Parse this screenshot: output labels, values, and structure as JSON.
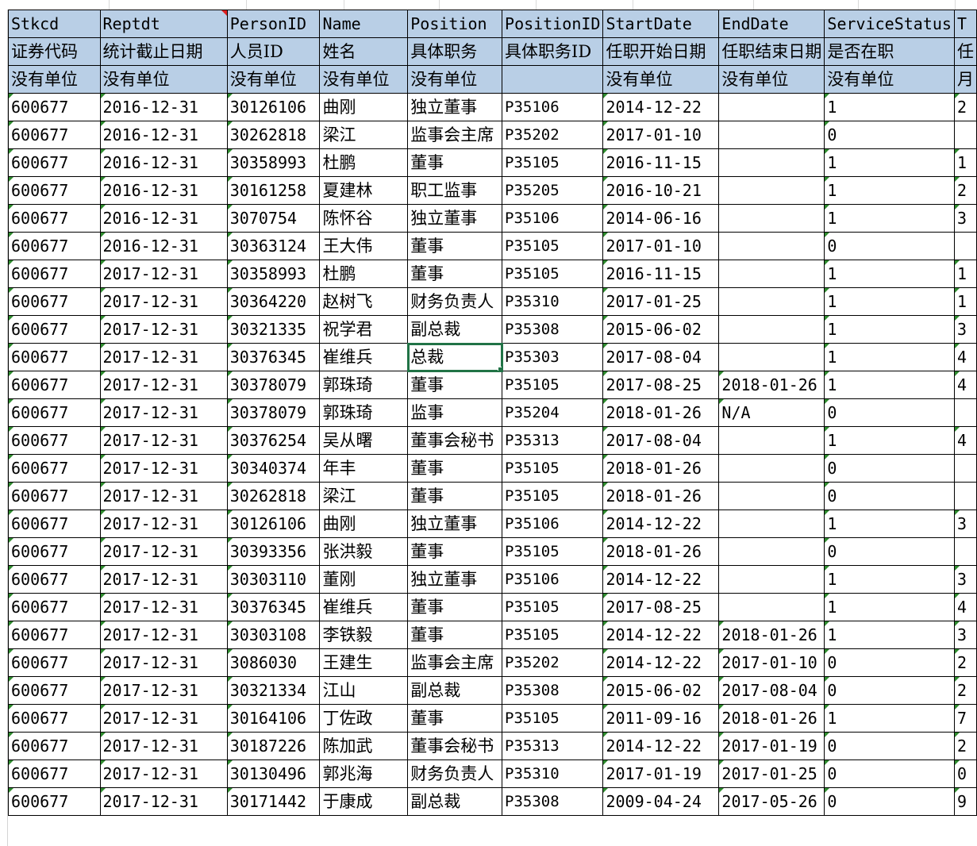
{
  "sheet": {
    "header_codes": [
      "Stkcd",
      "Reptdt",
      "PersonID",
      "Name",
      "Position",
      "PositionID",
      "StartDate",
      "EndDate",
      "ServiceStatus",
      "T"
    ],
    "header_cn": [
      "证券代码",
      "统计截止日期",
      "人员ID",
      "姓名",
      "具体职务",
      "具体职务ID",
      "任职开始日期",
      "任职结束日期",
      "是否在职",
      "任"
    ],
    "header_units": [
      "没有单位",
      "没有单位",
      "没有单位",
      "没有单位",
      "没有单位",
      "",
      "没有单位",
      "没有单位",
      "没有单位",
      "月"
    ],
    "rows": [
      [
        "600677",
        "2016-12-31",
        "30126106",
        "曲刚",
        "独立董事",
        "P35106",
        "2014-12-22",
        "",
        "1",
        "2"
      ],
      [
        "600677",
        "2016-12-31",
        "30262818",
        "梁江",
        "监事会主席",
        "P35202",
        "2017-01-10",
        "",
        "0",
        ""
      ],
      [
        "600677",
        "2016-12-31",
        "30358993",
        "杜鹏",
        "董事",
        "P35105",
        "2016-11-15",
        "",
        "1",
        "1"
      ],
      [
        "600677",
        "2016-12-31",
        "30161258",
        "夏建林",
        "职工监事",
        "P35205",
        "2016-10-21",
        "",
        "1",
        "2"
      ],
      [
        "600677",
        "2016-12-31",
        "3070754",
        "陈怀谷",
        "独立董事",
        "P35106",
        "2014-06-16",
        "",
        "1",
        "3"
      ],
      [
        "600677",
        "2016-12-31",
        "30363124",
        "王大伟",
        "董事",
        "P35105",
        "2017-01-10",
        "",
        "0",
        ""
      ],
      [
        "600677",
        "2017-12-31",
        "30358993",
        "杜鹏",
        "董事",
        "P35105",
        "2016-11-15",
        "",
        "1",
        "1"
      ],
      [
        "600677",
        "2017-12-31",
        "30364220",
        "赵树飞",
        "财务负责人",
        "P35310",
        "2017-01-25",
        "",
        "1",
        "1"
      ],
      [
        "600677",
        "2017-12-31",
        "30321335",
        "祝学君",
        "副总裁",
        "P35308",
        "2015-06-02",
        "",
        "1",
        "3"
      ],
      [
        "600677",
        "2017-12-31",
        "30376345",
        "崔维兵",
        "总裁",
        "P35303",
        "2017-08-04",
        "",
        "1",
        "4"
      ],
      [
        "600677",
        "2017-12-31",
        "30378079",
        "郭珠琦",
        "董事",
        "P35105",
        "2017-08-25",
        "2018-01-26",
        "1",
        "4"
      ],
      [
        "600677",
        "2017-12-31",
        "30378079",
        "郭珠琦",
        "监事",
        "P35204",
        "2018-01-26",
        "N/A",
        "0",
        ""
      ],
      [
        "600677",
        "2017-12-31",
        "30376254",
        "吴从曙",
        "董事会秘书",
        "P35313",
        "2017-08-04",
        "",
        "1",
        "4"
      ],
      [
        "600677",
        "2017-12-31",
        "30340374",
        "年丰",
        "董事",
        "P35105",
        "2018-01-26",
        "",
        "0",
        ""
      ],
      [
        "600677",
        "2017-12-31",
        "30262818",
        "梁江",
        "董事",
        "P35105",
        "2018-01-26",
        "",
        "0",
        ""
      ],
      [
        "600677",
        "2017-12-31",
        "30126106",
        "曲刚",
        "独立董事",
        "P35106",
        "2014-12-22",
        "",
        "1",
        "3"
      ],
      [
        "600677",
        "2017-12-31",
        "30393356",
        "张洪毅",
        "董事",
        "P35105",
        "2018-01-26",
        "",
        "0",
        ""
      ],
      [
        "600677",
        "2017-12-31",
        "30303110",
        "董刚",
        "独立董事",
        "P35106",
        "2014-12-22",
        "",
        "1",
        "3"
      ],
      [
        "600677",
        "2017-12-31",
        "30376345",
        "崔维兵",
        "董事",
        "P35105",
        "2017-08-25",
        "",
        "1",
        "4"
      ],
      [
        "600677",
        "2017-12-31",
        "30303108",
        "李铁毅",
        "董事",
        "P35105",
        "2014-12-22",
        "2018-01-26",
        "1",
        "3"
      ],
      [
        "600677",
        "2017-12-31",
        "3086030",
        "王建生",
        "监事会主席",
        "P35202",
        "2014-12-22",
        "2017-01-10",
        "0",
        "2"
      ],
      [
        "600677",
        "2017-12-31",
        "30321334",
        "江山",
        "副总裁",
        "P35308",
        "2015-06-02",
        "2017-08-04",
        "0",
        "2"
      ],
      [
        "600677",
        "2017-12-31",
        "30164106",
        "丁佐政",
        "董事",
        "P35105",
        "2011-09-16",
        "2018-01-26",
        "1",
        "7"
      ],
      [
        "600677",
        "2017-12-31",
        "30187226",
        "陈加武",
        "董事会秘书",
        "P35313",
        "2014-12-22",
        "2017-01-19",
        "0",
        "2"
      ],
      [
        "600677",
        "2017-12-31",
        "30130496",
        "郭兆海",
        "财务负责人",
        "P35310",
        "2017-01-19",
        "2017-01-25",
        "0",
        "0"
      ],
      [
        "600677",
        "2017-12-31",
        "30171442",
        "于康成",
        "副总裁",
        "P35308",
        "2009-04-24",
        "2017-05-26",
        "0",
        "9"
      ]
    ],
    "selected_row": 9,
    "selected_col": 4
  },
  "colors": {
    "header_fill": "#b9cfe6",
    "selection": "#217346",
    "text_indicator": "#2e8b2e",
    "comment_indicator": "#e02020"
  }
}
